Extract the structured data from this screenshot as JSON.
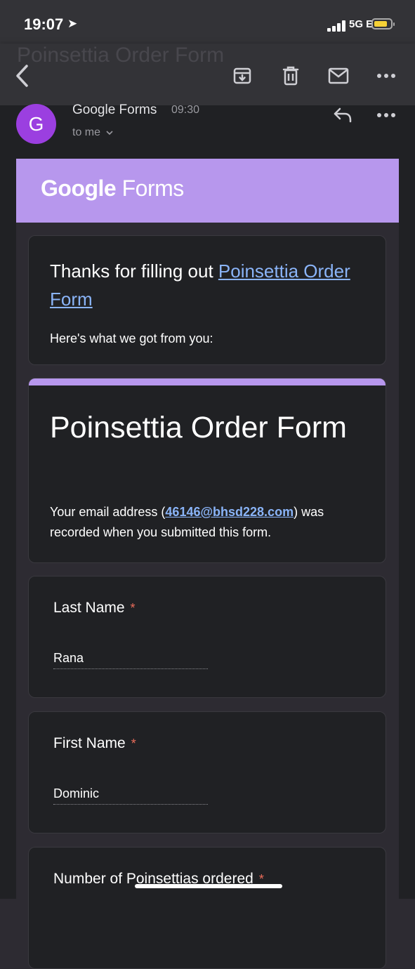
{
  "status_bar": {
    "time": "19:07",
    "network": "5G E"
  },
  "toolbar": {
    "background_title": "Poinsettia Order Form"
  },
  "email": {
    "avatar_letter": "G",
    "sender": "Google Forms",
    "time": "09:30",
    "recipient": "to me"
  },
  "banner": {
    "logo_word1": "Google",
    "logo_word2": "Forms"
  },
  "thanks": {
    "prefix": "Thanks for filling out ",
    "link_text": "Poinsettia Order Form",
    "subtitle": "Here's what we got from you:"
  },
  "form": {
    "title": "Poinsettia Order Form",
    "note_prefix": "Your email address (",
    "email": "46146@bhsd228.com",
    "note_suffix": ") was recorded when you submitted this form."
  },
  "questions": [
    {
      "label": "Last Name",
      "required_mark": "*",
      "answer": "Rana"
    },
    {
      "label": "First Name",
      "required_mark": "*",
      "answer": "Dominic"
    },
    {
      "label": "Number of Poinsettias ordered",
      "required_mark": "*",
      "answer": ""
    }
  ],
  "colors": {
    "accent": "#b797ed",
    "link": "#8ab4f8",
    "avatar": "#9b3fe0",
    "required": "#ea6c5a",
    "battery": "#f5d136"
  }
}
